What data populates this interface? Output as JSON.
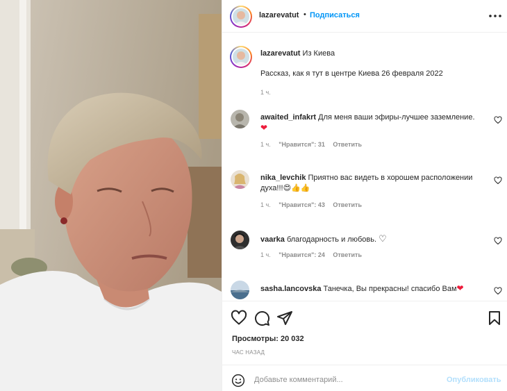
{
  "post": {
    "username": "lazarevatut",
    "separator": "•",
    "follow_label": "Подписаться",
    "more_icon": "more-horizontal-icon"
  },
  "caption": {
    "username": "lazarevatut",
    "location_text": "Из Киева",
    "story": "Рассказ, как я тут в центре Киева 26 февраля 2022",
    "time": "1 ч."
  },
  "comments": [
    {
      "username": "awaited_infakrt",
      "text": "Для меня ваши эфиры-лучшее заземление.",
      "emoji": "❤",
      "time": "1 ч.",
      "likes": "\"Нравится\": 31",
      "reply": "Ответить"
    },
    {
      "username": "nika_levchik",
      "text": "Приятно вас видеть в хорошем расположении духа!!!",
      "emoji": "😍👍👍",
      "time": "1 ч.",
      "likes": "\"Нравится\": 43",
      "reply": "Ответить"
    },
    {
      "username": "vaarka",
      "text": "благодарность и любовь.",
      "emoji": "♡",
      "time": "1 ч.",
      "likes": "\"Нравится\": 24",
      "reply": "Ответить"
    },
    {
      "username": "sasha.lancovska",
      "text": "Танечка, Вы прекрасны! спасибо Вам",
      "emoji": "❤",
      "time": "",
      "likes": "",
      "reply": ""
    }
  ],
  "actions": {
    "like_icon": "heart-icon",
    "comment_icon": "comment-icon",
    "share_icon": "send-icon",
    "save_icon": "bookmark-icon",
    "views_label": "Просмотры: 20 032",
    "ago_label": "ЧАС НАЗАД"
  },
  "composer": {
    "emoji_icon": "smiley-icon",
    "placeholder": "Добавьте комментарий...",
    "publish_label": "Опубликовать"
  },
  "colors": {
    "accent": "#0095f6",
    "publish_disabled": "#b2dffc",
    "muted": "#8e8e8e",
    "heart_red": "#ed1c3b"
  }
}
